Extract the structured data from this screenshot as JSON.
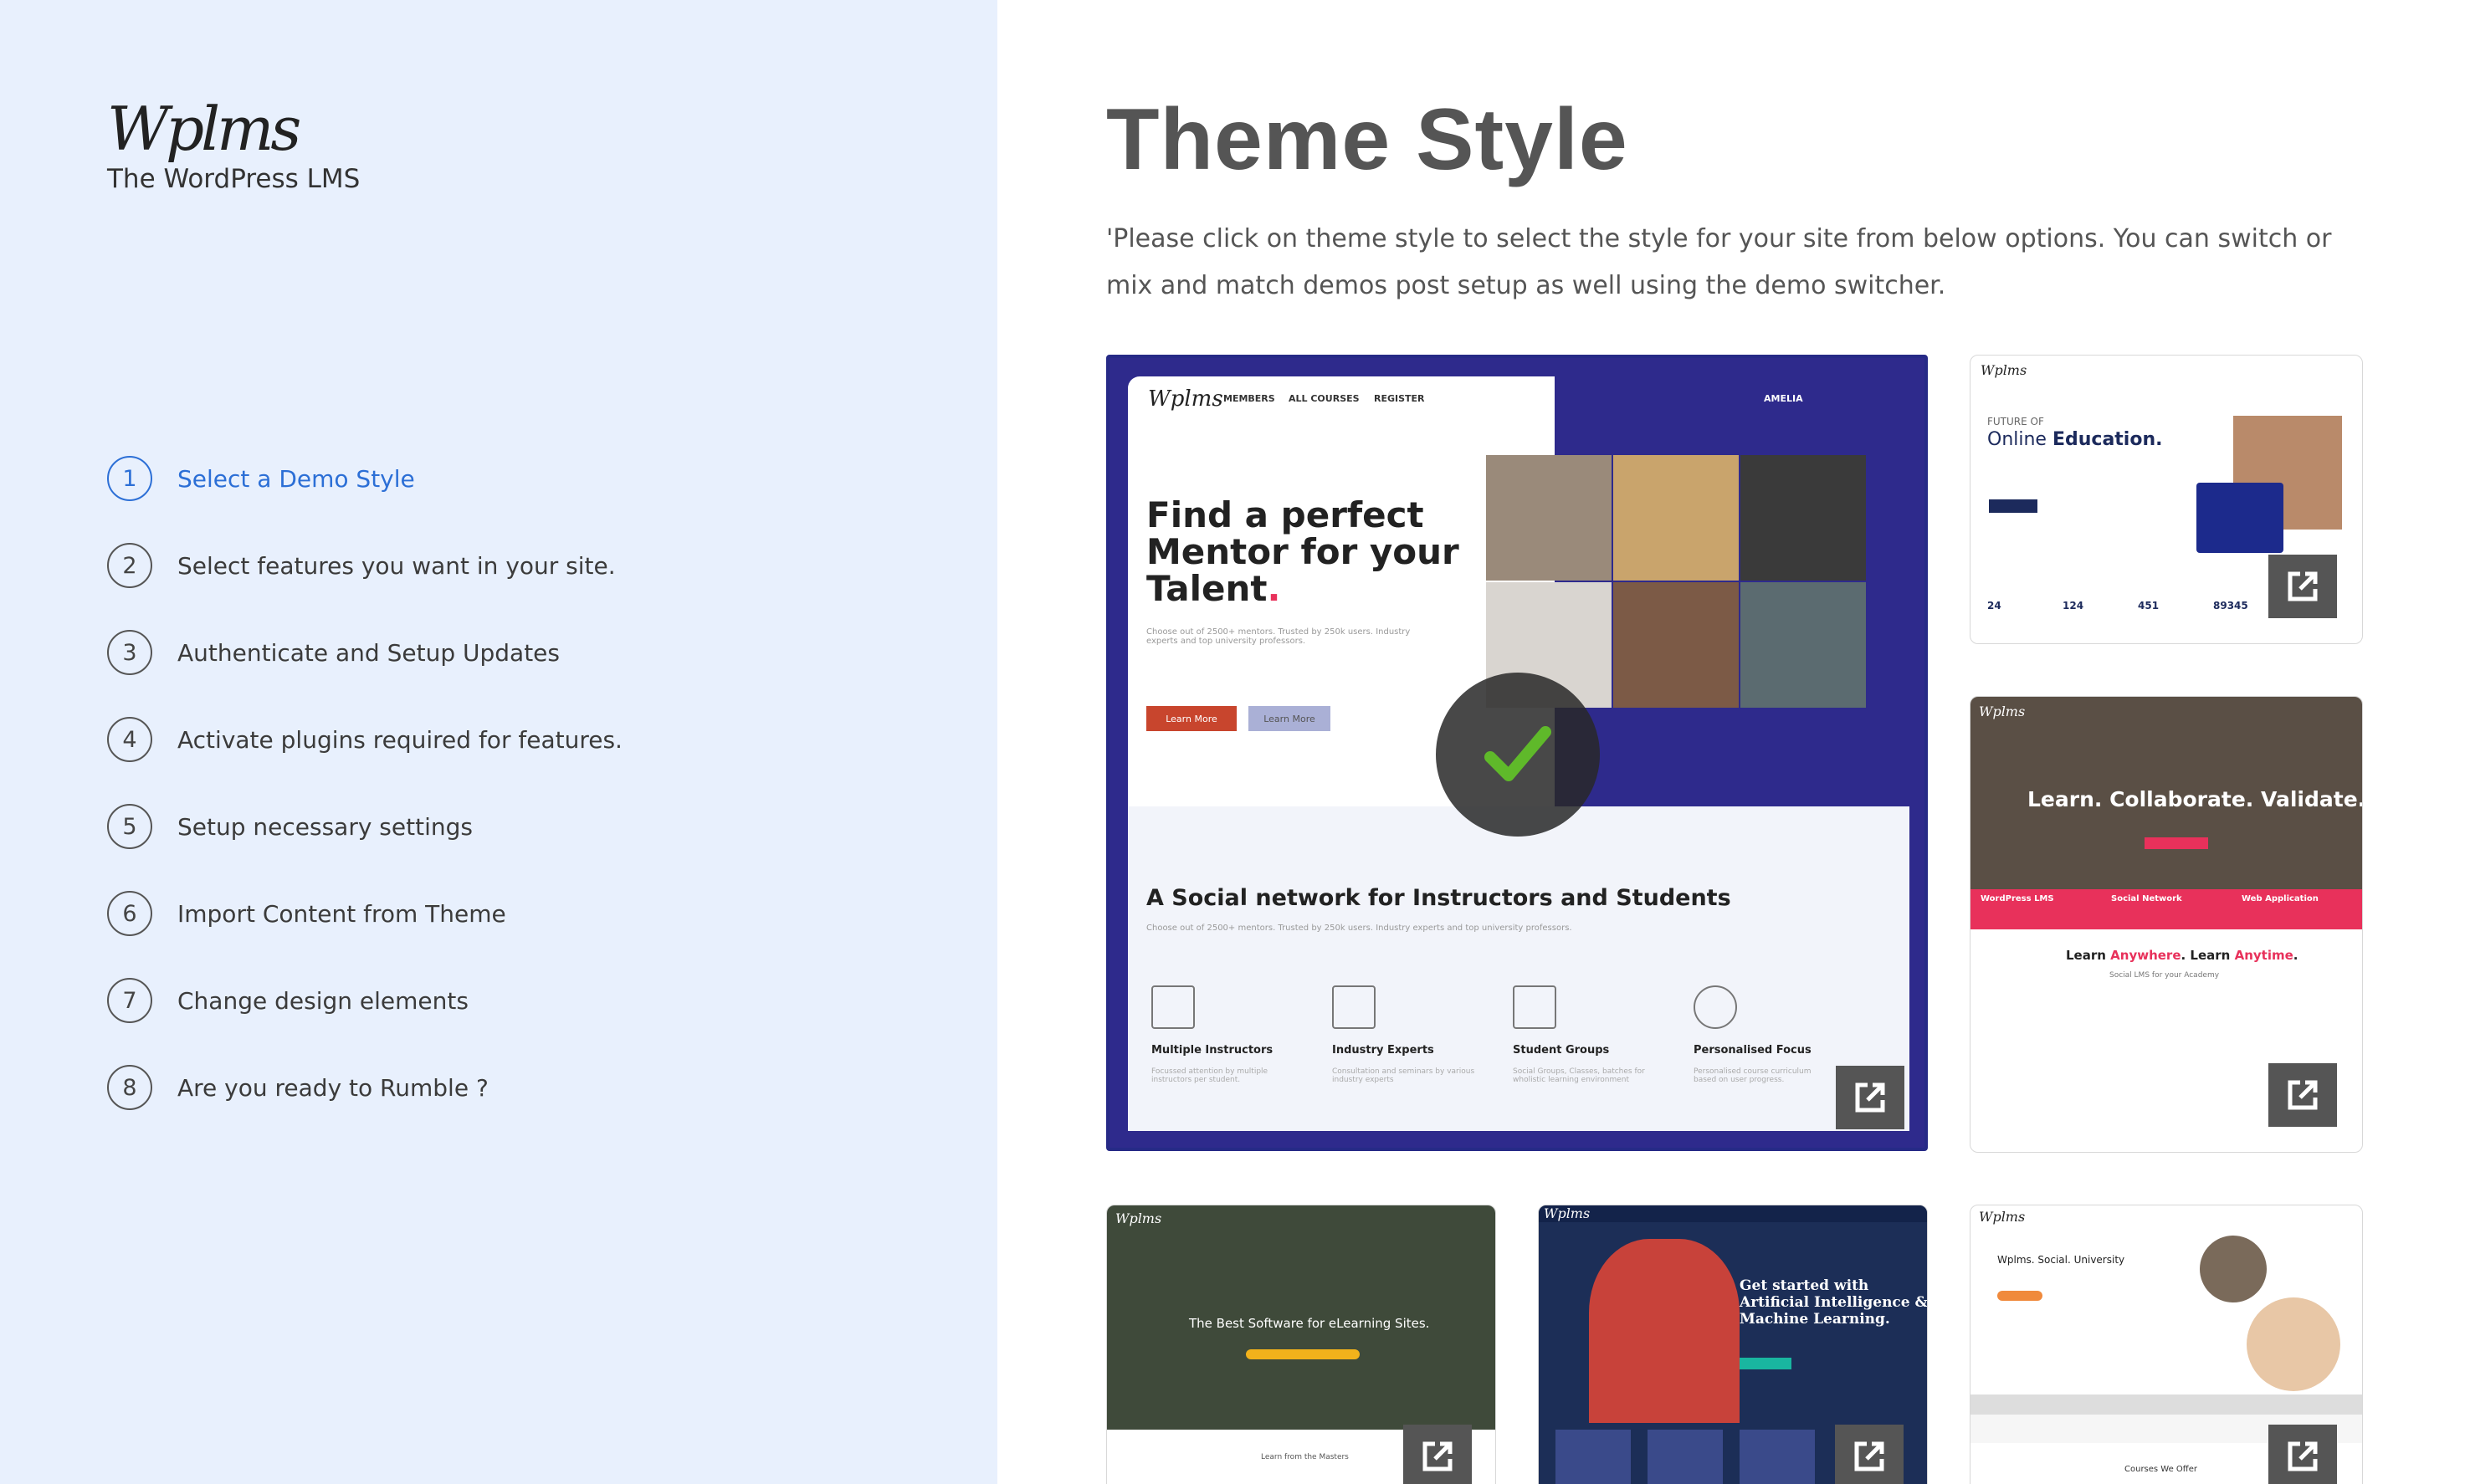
{
  "brand": {
    "logo": "Wplms",
    "tagline": "The WordPress LMS"
  },
  "steps": [
    {
      "num": "1",
      "label": "Select a Demo Style",
      "active": true
    },
    {
      "num": "2",
      "label": "Select features you want in your site."
    },
    {
      "num": "3",
      "label": "Authenticate and Setup Updates"
    },
    {
      "num": "4",
      "label": "Activate plugins required for features."
    },
    {
      "num": "5",
      "label": "Setup necessary settings"
    },
    {
      "num": "6",
      "label": "Import Content from Theme"
    },
    {
      "num": "7",
      "label": "Change design elements"
    },
    {
      "num": "8",
      "label": "Are you ready to Rumble ?"
    }
  ],
  "page": {
    "title": "Theme Style",
    "description": "'Please click on theme style to select the style for your site from below options. You can switch or mix and match demos post setup as well using the demo switcher."
  },
  "demo1": {
    "logo": "Wplms",
    "nav": [
      "MEMBERS",
      "ALL COURSES",
      "REGISTER"
    ],
    "user": "AMELIA",
    "h1a": "Find a perfect",
    "h1b": "Mentor for your",
    "h1c": "Talent",
    "dot": ".",
    "sub": "Choose out of 2500+ mentors. Trusted by 250k users. Industry experts and top university professors.",
    "btn1": "Learn More",
    "btn2": "Learn More",
    "h2": "A Social network for Instructors and Students",
    "sub2": "Choose out of 2500+ mentors. Trusted by 250k users. Industry experts and top university professors.",
    "features": [
      {
        "t": "Multiple Instructors",
        "d": "Focussed attention by multiple instructors per student."
      },
      {
        "t": "Industry Experts",
        "d": "Consultation and seminars by various industry experts"
      },
      {
        "t": "Student Groups",
        "d": "Social Groups, Classes, batches for wholistic learning environment"
      },
      {
        "t": "Personalised Focus",
        "d": "Personalised course curriculum based on user progress."
      }
    ]
  },
  "demo2": {
    "logo": "Wplms",
    "kicker": "FUTURE OF",
    "head1": "Online ",
    "head2": "Education.",
    "stats": [
      "24",
      "124",
      "451",
      "89345"
    ]
  },
  "demo3": {
    "logo": "Wplms",
    "head": "Learn. Collaborate. Validate.",
    "chips": [
      "WordPress LMS",
      "Social Network",
      "Web Application"
    ],
    "tag1": "Learn ",
    "tag2": "Anywhere",
    "tag3": ". Learn ",
    "tag4": "Anytime",
    "tag5": ".",
    "sub": "Social LMS for your Academy"
  },
  "demo4": {
    "logo": "Wplms",
    "head": "The Best Software for eLearning Sites.",
    "foot": "Learn from the Masters"
  },
  "demo5": {
    "logo": "Wplms",
    "head1": "Get started with",
    "head2": "Artificial Intelligence &",
    "head3": "Machine Learning."
  },
  "demo6": {
    "logo": "Wplms",
    "head": "Wplms. Social. University",
    "foot": "Courses We Offer"
  },
  "colors": {
    "accent": "#2c6fd6",
    "sidebar": "#e8f0fd",
    "demoPurple": "#2e2a8c",
    "pink": "#e8315b"
  }
}
